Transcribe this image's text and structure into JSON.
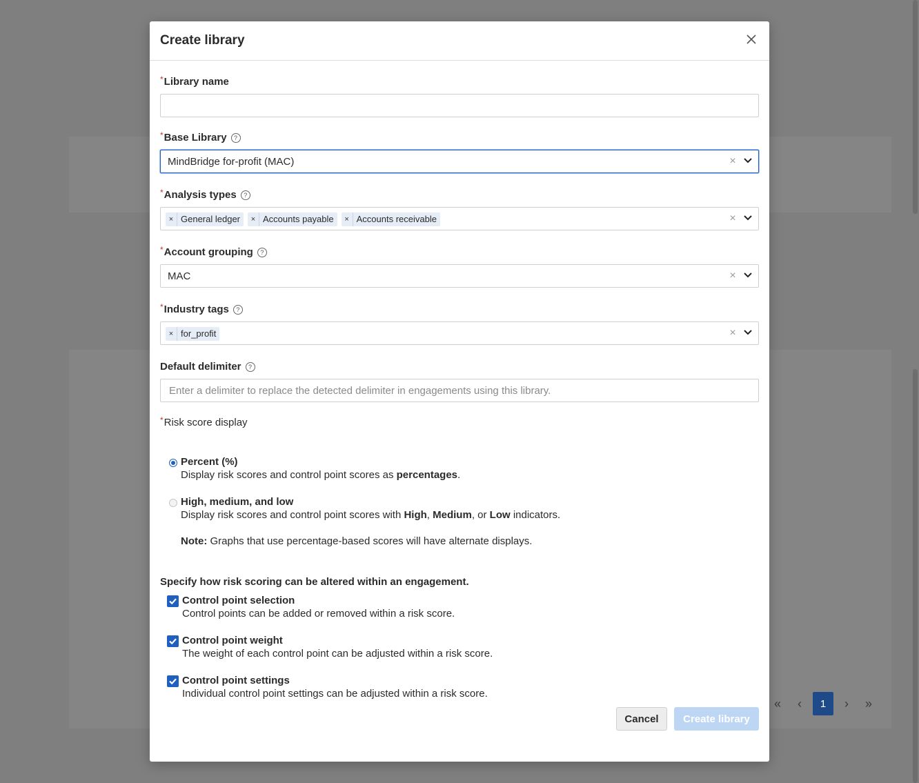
{
  "modal": {
    "title": "Create library",
    "close_icon": "close-icon"
  },
  "fields": {
    "library_name": {
      "label": "Library name",
      "value": "",
      "placeholder": ""
    },
    "base_library": {
      "label": "Base Library",
      "value": "MindBridge for-profit (MAC)"
    },
    "analysis_types": {
      "label": "Analysis types",
      "chips": [
        "General ledger",
        "Accounts payable",
        "Accounts receivable"
      ]
    },
    "account_grouping": {
      "label": "Account grouping",
      "value": "MAC"
    },
    "industry_tags": {
      "label": "Industry tags",
      "chips": [
        "for_profit"
      ]
    },
    "default_delimiter": {
      "label": "Default delimiter",
      "placeholder": "Enter a delimiter to replace the detected delimiter in engagements using this library."
    }
  },
  "risk_score": {
    "label": "Risk score display",
    "options": [
      {
        "title": "Percent (%)",
        "desc_pre": "Display risk scores and control point scores as ",
        "desc_bold": "percentages",
        "desc_post": ".",
        "selected": true
      },
      {
        "title": "High, medium, and low",
        "desc_pre": "Display risk scores and control point scores with ",
        "b1": "High",
        "sep1": ", ",
        "b2": "Medium",
        "sep2": ", or ",
        "b3": "Low",
        "desc_post": " indicators.",
        "selected": false
      }
    ],
    "note_label": "Note:",
    "note_text": " Graphs that use percentage-based scores will have alternate displays."
  },
  "alterations": {
    "heading": "Specify how risk scoring can be altered within an engagement.",
    "items": [
      {
        "title": "Control point selection",
        "desc": "Control points can be added or removed within a risk score.",
        "checked": true
      },
      {
        "title": "Control point weight",
        "desc": "The weight of each control point can be adjusted within a risk score.",
        "checked": true
      },
      {
        "title": "Control point settings",
        "desc": "Individual control point settings can be adjusted within a risk score.",
        "checked": true
      }
    ]
  },
  "footer": {
    "cancel_label": "Cancel",
    "create_label": "Create library"
  },
  "background_pager": {
    "first": "«",
    "prev": "‹",
    "current": "1",
    "next": "›",
    "last": "»"
  },
  "colors": {
    "accent": "#1f5fbf",
    "create_disabled": "#bcd6f3",
    "required": "#c0392b"
  }
}
